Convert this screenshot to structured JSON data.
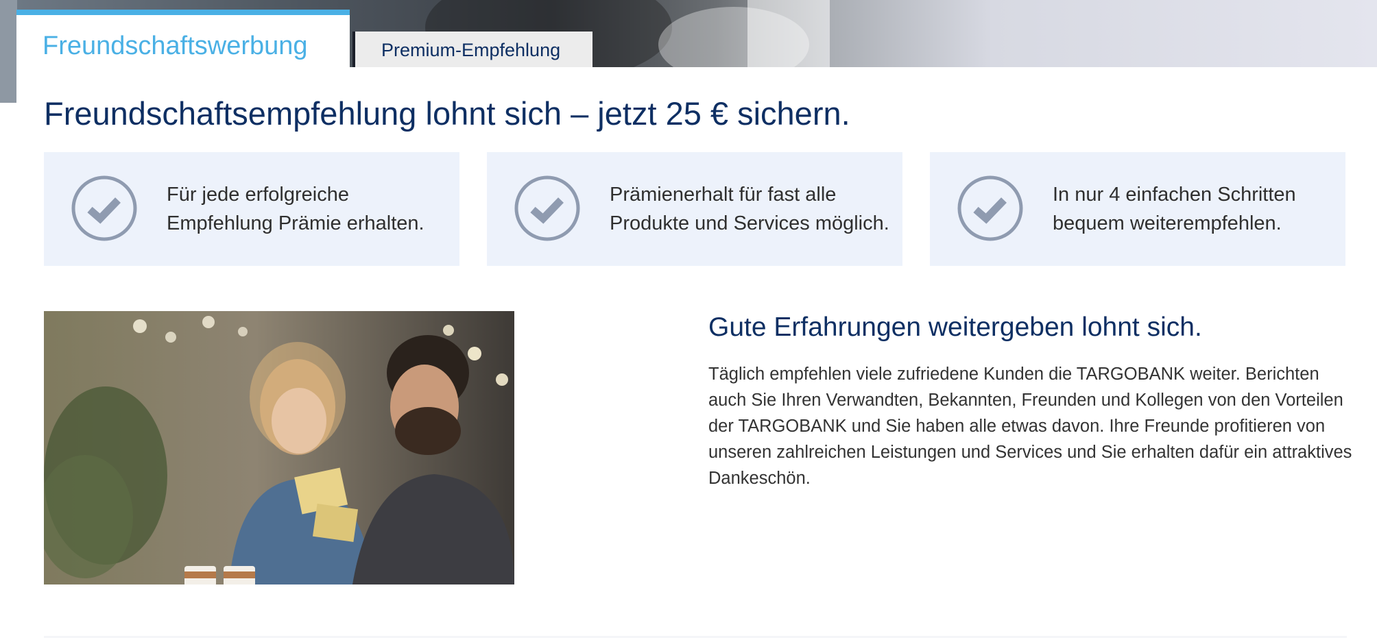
{
  "tabs": [
    {
      "label": "Freundschaftswerbung",
      "active": true
    },
    {
      "label": "Premium-Empfehlung",
      "active": false
    }
  ],
  "headline": "Freundschaftsempfehlung lohnt sich – jetzt 25 € sichern.",
  "features": [
    {
      "icon": "checkmark-icon",
      "text": "Für jede erfolgreiche Empfehlung Prämie erhalten."
    },
    {
      "icon": "checkmark-icon",
      "text": "Prämienerhalt für fast alle Produkte und Services möglich."
    },
    {
      "icon": "checkmark-icon",
      "text": "In nur 4 einfachen Schritten bequem weiterempfehlen."
    }
  ],
  "section": {
    "title": "Gute Erfahrungen weitergeben lohnt sich.",
    "body": "Täglich empfehlen viele zufriedene Kunden die TARGOBANK weiter. Berichten auch Sie Ihren Verwandten, Bekannten, Freunden und Kollegen von den Vorteilen der TARGOBANK und Sie haben alle etwas davon. Ihre Freunde profitieren von unseren zahlreichen Leistungen und Services und Sie erhalten dafür ein attraktives Dankeschön."
  },
  "colors": {
    "accent": "#4ab0e5",
    "primary_text": "#0e2f63",
    "feature_bg": "#edf2fb",
    "check_icon": "#8f9bb0"
  }
}
